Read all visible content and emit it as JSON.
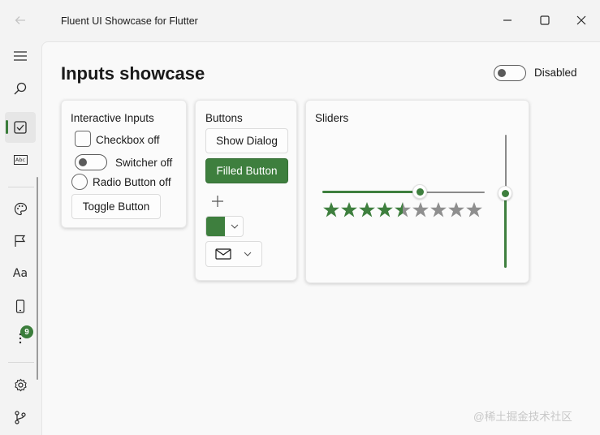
{
  "window": {
    "title": "Fluent UI Showcase for Flutter",
    "controls": [
      "minimize-icon",
      "maximize-icon",
      "close-icon"
    ]
  },
  "nav": {
    "items": [
      "menu-icon",
      "search-icon",
      "checkbox-icon",
      "text-box-icon",
      "palette-icon",
      "flag-icon",
      "typography-icon",
      "mobile-icon",
      "more-icon",
      "settings-icon",
      "source-control-icon"
    ],
    "selected": "checkbox-icon",
    "typography_label": "Aa",
    "textbox_label": "Abc",
    "badge_count": "9",
    "accent": "#3e7f3e"
  },
  "header": {
    "title": "Inputs showcase",
    "disabled_toggle": {
      "label": "Disabled",
      "on": false
    }
  },
  "interactive_card": {
    "title": "Interactive Inputs",
    "checkbox_label": "Checkbox off",
    "switcher_label": "Switcher off",
    "radio_label": "Radio Button off",
    "toggle_button_label": "Toggle Button"
  },
  "buttons_card": {
    "title": "Buttons",
    "show_dialog_label": "Show Dialog",
    "filled_button_label": "Filled Button",
    "color_swatch": "#3e7f3e"
  },
  "sliders_card": {
    "title": "Sliders",
    "horizontal_value": 0.5,
    "vertical_value": 0.5,
    "rating": 4.5,
    "rating_max": 9
  },
  "watermark": "@稀土掘金技术社区"
}
